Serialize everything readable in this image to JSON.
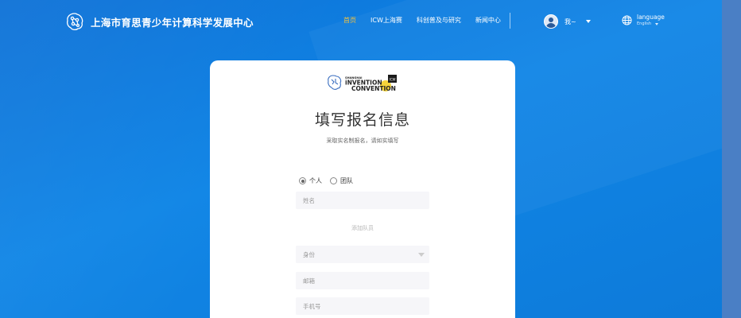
{
  "header": {
    "site_title": "上海市育思青少年计算科学发展中心",
    "nav": [
      {
        "label": "首页",
        "active": true
      },
      {
        "label": "ICW上海赛",
        "active": false
      },
      {
        "label": "科创普及与研究",
        "active": false
      },
      {
        "label": "新闻中心",
        "active": false
      }
    ],
    "user": {
      "name": "我~"
    },
    "language": {
      "title": "language",
      "current": "English"
    }
  },
  "card": {
    "logo_lines": [
      "SHANGHAI",
      "iNVENTION",
      "CONVENTION"
    ],
    "logo_badge": "ICW",
    "title": "填写报名信息",
    "subtitle": "采取实名制报名，请如实填写",
    "entry_type": {
      "options": [
        {
          "label": "个人",
          "checked": true
        },
        {
          "label": "团队",
          "checked": false
        }
      ]
    },
    "fields": {
      "name_placeholder": "姓名",
      "add_member": "添加队员",
      "role_placeholder": "身份",
      "email_placeholder": "邮箱",
      "phone_placeholder": "手机号"
    }
  },
  "colors": {
    "background": "#0d7ad9",
    "active_nav": "#f5c23b",
    "card": "#ffffff",
    "input_bg": "#f6f6f9"
  }
}
